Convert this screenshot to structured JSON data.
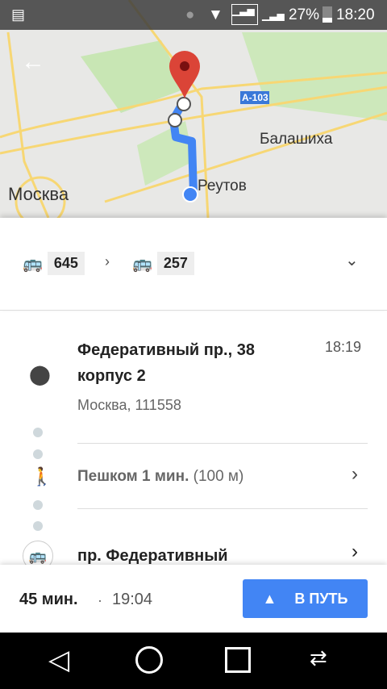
{
  "status": {
    "battery": "27%",
    "time": "18:20"
  },
  "map": {
    "labels": {
      "moscow": "Москва",
      "balashikha": "Балашиха",
      "reutov": "Реутов",
      "road": "A-103"
    }
  },
  "summary": {
    "routes": [
      "645",
      "257"
    ]
  },
  "steps": {
    "origin": {
      "title": "Федеративный пр., 38 корпус 2",
      "subtitle": "Москва, 111558",
      "time": "18:19"
    },
    "walk": {
      "label": "Пешком 1 мин.",
      "distance": "(100 м)"
    },
    "stop": {
      "label": "пр. Федеративный"
    }
  },
  "bottom": {
    "duration": "45 мин.",
    "separator": "·",
    "arrival": "19:04",
    "go_label": "В ПУТЬ"
  },
  "colors": {
    "accent": "#4285f4",
    "pin": "#db4437"
  }
}
